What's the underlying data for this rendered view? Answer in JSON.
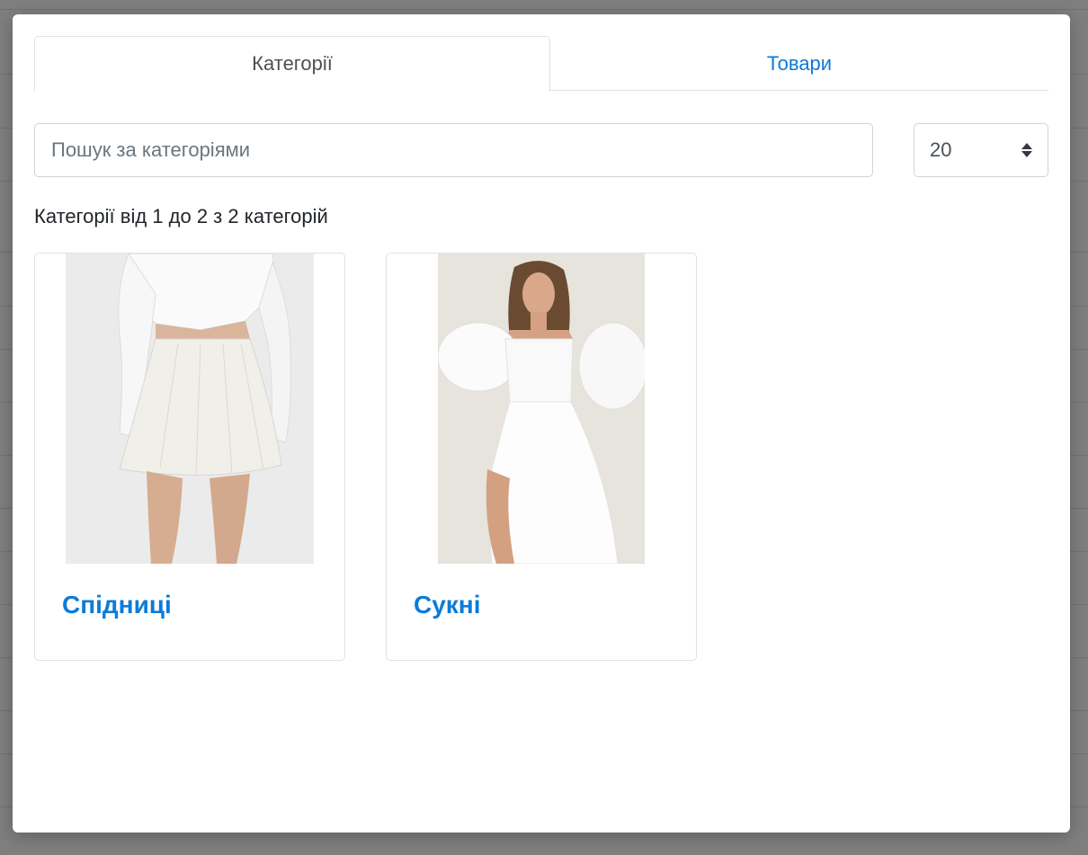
{
  "tabs": [
    {
      "label": "Категорії",
      "active": true
    },
    {
      "label": "Товари",
      "active": false
    }
  ],
  "search": {
    "placeholder": "Пошук за категоріями",
    "value": ""
  },
  "per_page": {
    "selected": "20"
  },
  "summary": "Категорії від 1 до 2 з 2 категорій",
  "categories": [
    {
      "title": "Спідниці",
      "image_icon": "photo-skirt"
    },
    {
      "title": "Сукні",
      "image_icon": "photo-dress"
    }
  ],
  "colors": {
    "link": "#0d7bd9",
    "border": "#dee2e6",
    "overlay": "rgba(0,0,0,0.5)"
  }
}
